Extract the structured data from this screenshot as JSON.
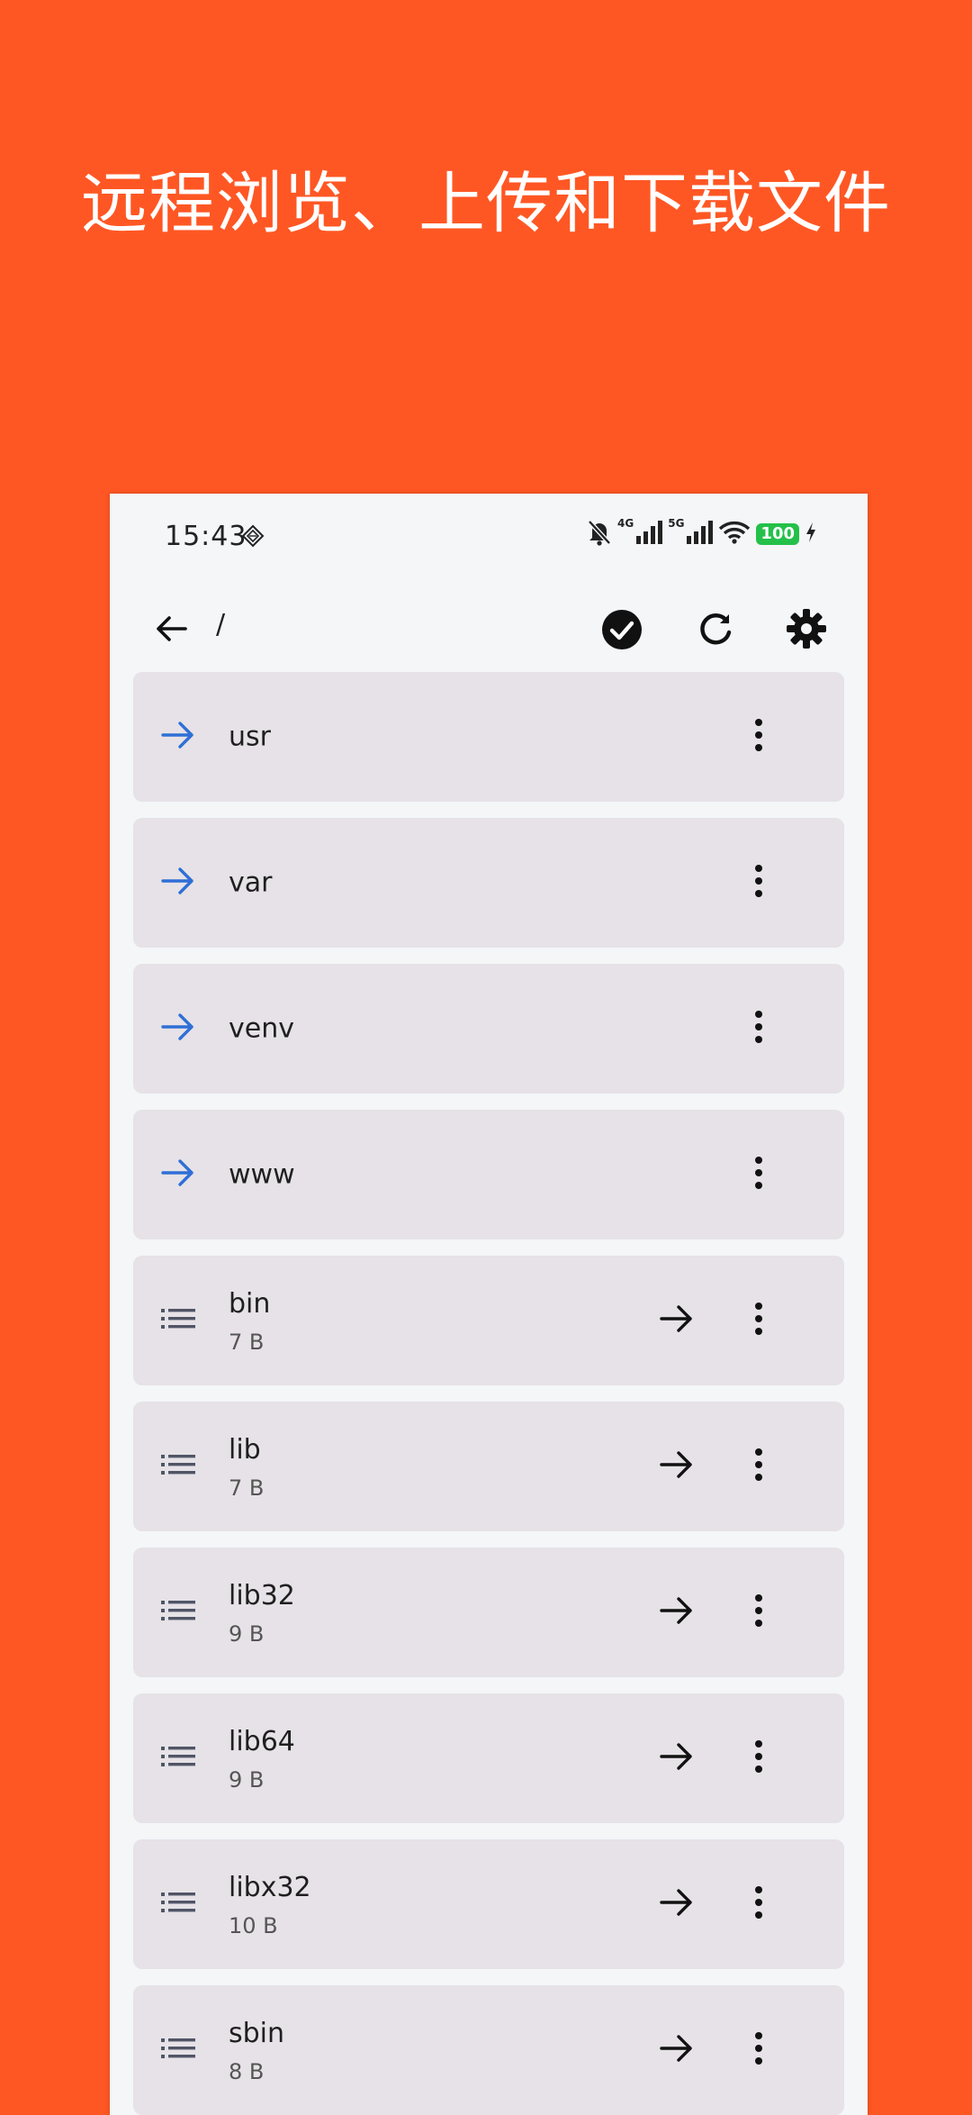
{
  "headline": "远程浏览、上传和下载文件",
  "status_bar": {
    "time": "15:43",
    "net1": "4G",
    "net2": "5G",
    "battery": "100"
  },
  "toolbar": {
    "path": "/"
  },
  "colors": {
    "background": "#FF5724",
    "folder_arrow": "#2F6FD6",
    "item_bg": "#E6E2E7",
    "battery": "#24C04A"
  },
  "items": [
    {
      "type": "folder",
      "name": "usr"
    },
    {
      "type": "folder",
      "name": "var"
    },
    {
      "type": "folder",
      "name": "venv"
    },
    {
      "type": "folder",
      "name": "www"
    },
    {
      "type": "file",
      "name": "bin",
      "size": "7 B"
    },
    {
      "type": "file",
      "name": "lib",
      "size": "7 B"
    },
    {
      "type": "file",
      "name": "lib32",
      "size": "9 B"
    },
    {
      "type": "file",
      "name": "lib64",
      "size": "9 B"
    },
    {
      "type": "file",
      "name": "libx32",
      "size": "10 B"
    },
    {
      "type": "file",
      "name": "sbin",
      "size": "8 B"
    }
  ]
}
